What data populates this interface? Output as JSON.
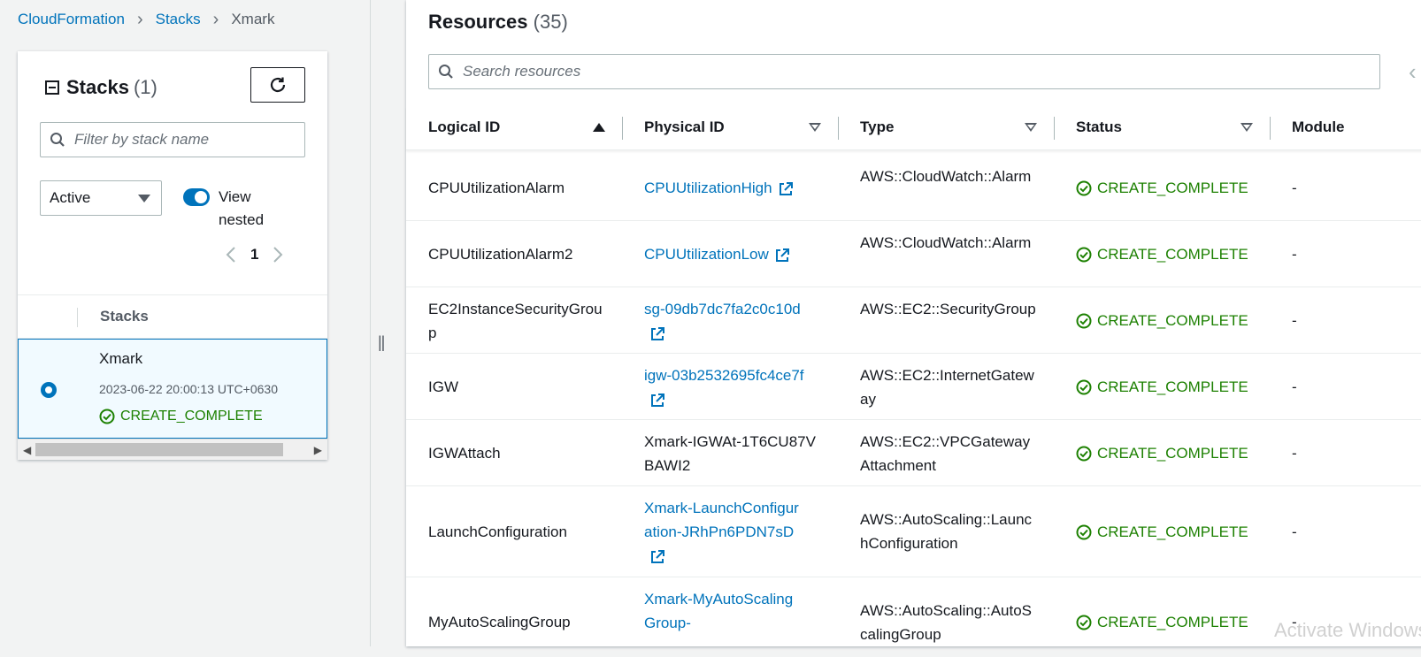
{
  "breadcrumb": {
    "items": [
      "CloudFormation",
      "Stacks",
      "Xmark"
    ]
  },
  "stacks_panel": {
    "title": "Stacks",
    "count": "(1)",
    "filter_placeholder": "Filter by stack name",
    "status_filter": "Active",
    "toggle_label": "View nested",
    "page": "1",
    "column_header": "Stacks",
    "stack": {
      "name": "Xmark",
      "date": "2023-06-22 20:00:13 UTC+0630",
      "status": "CREATE_COMPLETE"
    }
  },
  "resources": {
    "title": "Resources",
    "count": "(35)",
    "search_placeholder": "Search resources",
    "columns": [
      "Logical ID",
      "Physical ID",
      "Type",
      "Status",
      "Module"
    ],
    "rows": [
      {
        "logical": "CPUUtilizationAlarm",
        "physical": "CPUUtilizationHigh",
        "physical_link": true,
        "type": "AWS::CloudWatch::Alarm",
        "status": "CREATE_COMPLETE",
        "module": "-"
      },
      {
        "logical": "CPUUtilizationAlarm2",
        "physical": "CPUUtilizationLow",
        "physical_link": true,
        "type": "AWS::CloudWatch::Alarm",
        "status": "CREATE_COMPLETE",
        "module": "-"
      },
      {
        "logical": "EC2InstanceSecurityGroup",
        "physical": "sg-09db7dc7fa2c0c10d",
        "physical_link": true,
        "type": "AWS::EC2::SecurityGroup",
        "status": "CREATE_COMPLETE",
        "module": "-"
      },
      {
        "logical": "IGW",
        "physical": "igw-03b2532695fc4ce7f",
        "physical_link": true,
        "type": "AWS::EC2::InternetGateway",
        "status": "CREATE_COMPLETE",
        "module": "-"
      },
      {
        "logical": "IGWAttach",
        "physical": "Xmark-IGWAt-1T6CU87VBAWI2",
        "physical_link": false,
        "type": "AWS::EC2::VPCGatewayAttachment",
        "status": "CREATE_COMPLETE",
        "module": "-"
      },
      {
        "logical": "LaunchConfiguration",
        "physical": "Xmark-LaunchConfiguration-JRhPn6PDN7sD",
        "physical_link": true,
        "type": "AWS::AutoScaling::LaunchConfiguration",
        "status": "CREATE_COMPLETE",
        "module": "-"
      },
      {
        "logical": "MyAutoScalingGroup",
        "physical": "Xmark-MyAutoScalingGroup-",
        "physical_link": true,
        "type": "AWS::AutoScaling::AutoScalingGroup",
        "status": "CREATE_COMPLETE",
        "module": "-"
      }
    ]
  },
  "watermark": "Activate Windows",
  "colors": {
    "link": "#0073bb",
    "success": "#1d8102",
    "selected_bg": "#f1faff"
  }
}
